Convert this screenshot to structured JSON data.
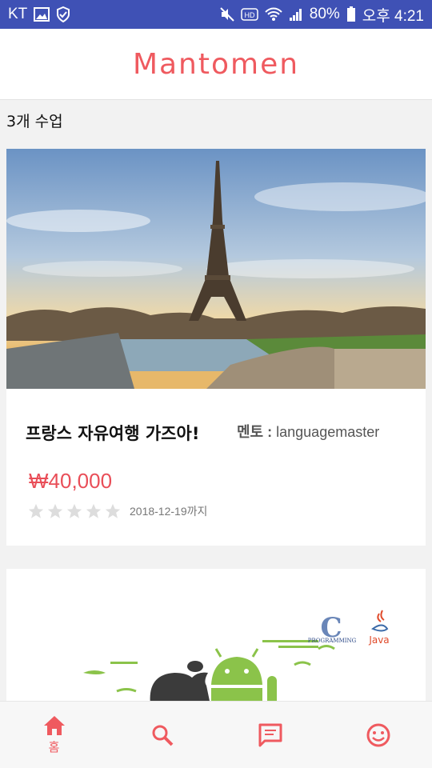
{
  "status_bar": {
    "carrier": "KT",
    "battery": "80%",
    "time": "오후 4:21"
  },
  "app": {
    "logo": "Mantomen"
  },
  "class_count": "3개 수업",
  "cards": [
    {
      "title": "프랑스 자유여행 가즈아!",
      "mentor_label": "멘토 :",
      "mentor_name": "languagemaster",
      "price": "₩40,000",
      "rating": 0,
      "deadline": "2018-12-19까지"
    }
  ],
  "card2_labels": {
    "c_label": "PROGRAMMING",
    "java_label": "Java"
  },
  "bottom_nav": {
    "home_label": "홈"
  },
  "colors": {
    "accent": "#ef5a5f",
    "status_bar": "#3f51b5",
    "star_empty": "#dddddd"
  }
}
